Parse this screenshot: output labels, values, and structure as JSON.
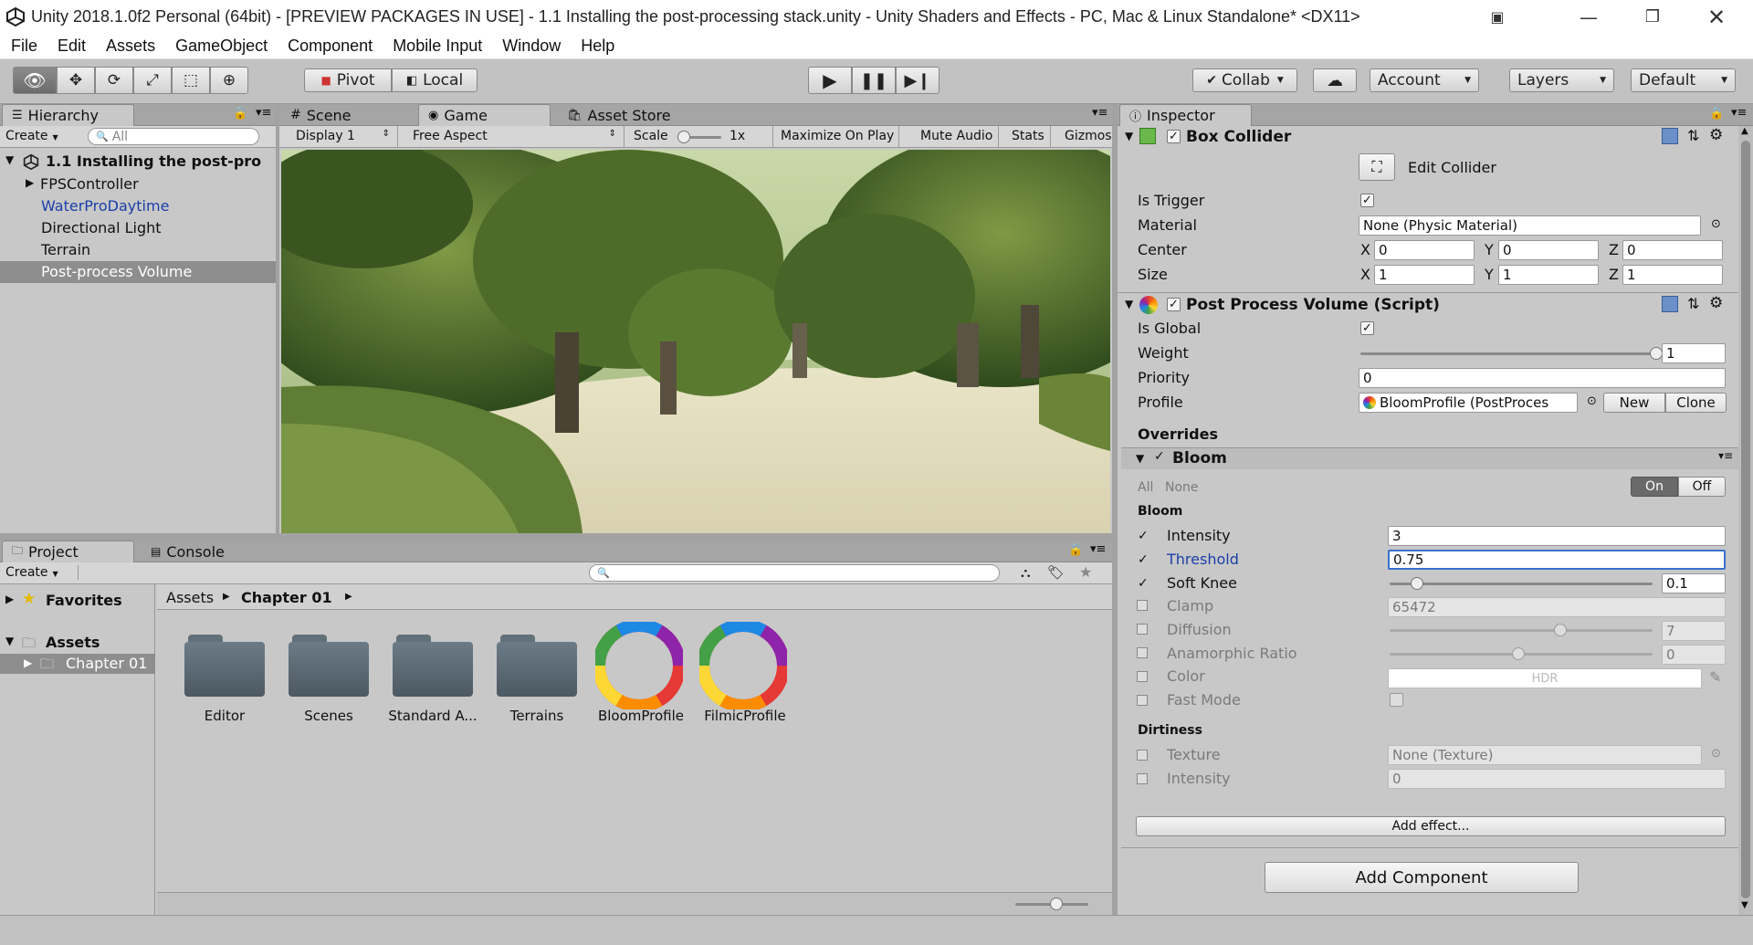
{
  "window": {
    "title": "Unity 2018.1.0f2 Personal (64bit) - [PREVIEW PACKAGES IN USE] - 1.1 Installing the post-processing stack.unity - Unity Shaders and Effects - PC, Mac & Linux Standalone* <DX11>"
  },
  "menu": [
    "File",
    "Edit",
    "Assets",
    "GameObject",
    "Component",
    "Mobile Input",
    "Window",
    "Help"
  ],
  "toolbar": {
    "pivot_label": "Pivot",
    "local_label": "Local",
    "collab_label": "Collab",
    "account_label": "Account",
    "layers_label": "Layers",
    "layout_label": "Default"
  },
  "hierarchy": {
    "tab_label": "Hierarchy",
    "create_label": "Create",
    "search_placeholder": "All",
    "scene_name": "1.1 Installing the post-pro",
    "items": [
      "FPSController",
      "WaterProDaytime",
      "Directional Light",
      "Terrain",
      "Post-process Volume"
    ]
  },
  "game_view": {
    "tabs": [
      "Scene",
      "Game",
      "Asset Store"
    ],
    "display_label": "Display 1",
    "aspect_label": "Free Aspect",
    "scale_label": "Scale",
    "scale_value": "1x",
    "toggles": [
      "Maximize On Play",
      "Mute Audio",
      "Stats",
      "Gizmos"
    ]
  },
  "project": {
    "tabs": [
      "Project",
      "Console"
    ],
    "create_label": "Create",
    "favorites_label": "Favorites",
    "assets_label": "Assets",
    "folder_chapter": "Chapter 01",
    "breadcrumb": [
      "Assets",
      "Chapter 01"
    ],
    "assets": [
      "Editor",
      "Scenes",
      "Standard A...",
      "Terrains",
      "BloomProfile",
      "FilmicProfile"
    ]
  },
  "inspector": {
    "tab_label": "Inspector",
    "box_collider": {
      "title": "Box Collider",
      "edit_collider_label": "Edit Collider",
      "is_trigger_label": "Is Trigger",
      "material_label": "Material",
      "material_value": "None (Physic Material)",
      "center_label": "Center",
      "size_label": "Size",
      "center": {
        "x": "0",
        "y": "0",
        "z": "0"
      },
      "size": {
        "x": "1",
        "y": "1",
        "z": "1"
      },
      "axis_labels": [
        "X",
        "Y",
        "Z"
      ]
    },
    "ppv": {
      "title": "Post Process Volume (Script)",
      "is_global_label": "Is Global",
      "weight_label": "Weight",
      "weight_value": "1",
      "weight_fraction": 1.0,
      "priority_label": "Priority",
      "priority_value": "0",
      "profile_label": "Profile",
      "profile_value": "BloomProfile (PostProces",
      "new_label": "New",
      "clone_label": "Clone",
      "overrides_label": "Overrides"
    },
    "bloom": {
      "title": "Bloom",
      "all_label": "All",
      "none_label": "None",
      "on_label": "On",
      "off_label": "Off",
      "section_label": "Bloom",
      "intensity_label": "Intensity",
      "intensity_value": "3",
      "threshold_label": "Threshold",
      "threshold_value": "0.75",
      "soft_knee_label": "Soft Knee",
      "soft_knee_value": "0.1",
      "clamp_label": "Clamp",
      "clamp_value": "65472",
      "diffusion_label": "Diffusion",
      "diffusion_value": "7",
      "anamorphic_label": "Anamorphic Ratio",
      "anamorphic_value": "0",
      "color_label": "Color",
      "color_value": "HDR",
      "fast_mode_label": "Fast Mode",
      "dirtiness_label": "Dirtiness",
      "texture_label": "Texture",
      "texture_value": "None (Texture)",
      "dirt_intensity_label": "Intensity",
      "dirt_intensity_value": "0"
    },
    "add_effect_label": "Add effect...",
    "add_component_label": "Add Component"
  }
}
